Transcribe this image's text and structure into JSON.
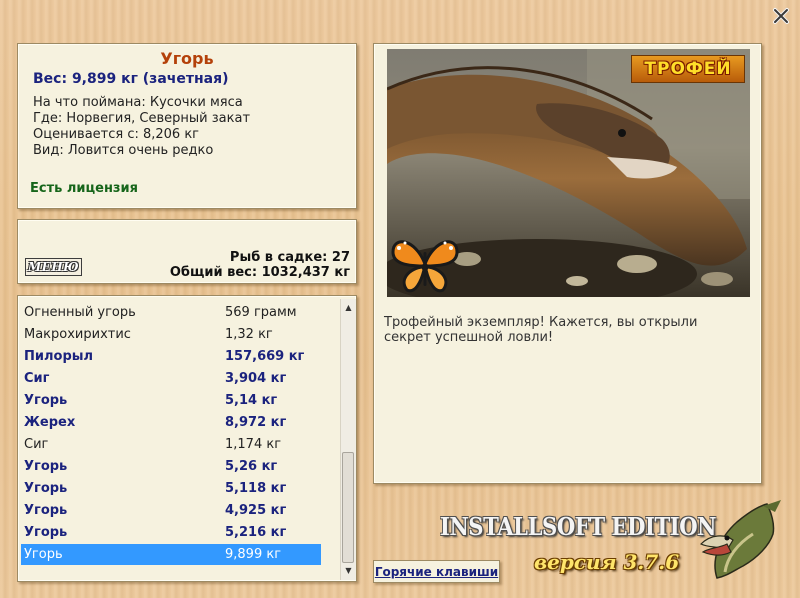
{
  "window": {
    "close_glyph": "✕"
  },
  "info": {
    "title": "Угорь",
    "weight": "Вес: 9,899 кг (зачетная)",
    "lines": [
      "На что поймана: Кусочки мяса",
      "Где: Норвегия, Северный закат",
      "Оценивается с: 8,206 кг",
      "Вид: Ловится очень редко"
    ],
    "license": "Есть лицензия"
  },
  "summary": {
    "menu_label": "МЕНЮ",
    "fish_count": "Рыб в садке: 27",
    "total_weight": "Общий вес: 1032,437 кг"
  },
  "catch_list": [
    {
      "name": "Огненный угорь",
      "weight": "569 грамм",
      "style": "normal"
    },
    {
      "name": "Макрохирихтис",
      "weight": "1,32 кг",
      "style": "normal"
    },
    {
      "name": "Пилорыл",
      "weight": "157,669 кг",
      "style": "bold"
    },
    {
      "name": "Сиг",
      "weight": "3,904 кг",
      "style": "bold"
    },
    {
      "name": "Угорь",
      "weight": "5,14 кг",
      "style": "bold"
    },
    {
      "name": "Жерех",
      "weight": "8,972 кг",
      "style": "bold"
    },
    {
      "name": "Сиг",
      "weight": "1,174 кг",
      "style": "normal"
    },
    {
      "name": "Угорь",
      "weight": "5,26 кг",
      "style": "bold"
    },
    {
      "name": "Угорь",
      "weight": "5,118 кг",
      "style": "bold"
    },
    {
      "name": "Угорь",
      "weight": "4,925 кг",
      "style": "bold"
    },
    {
      "name": "Угорь",
      "weight": "5,216 кг",
      "style": "bold"
    },
    {
      "name": "Угорь",
      "weight": "9,899 кг",
      "style": "selected"
    }
  ],
  "scrollbar": {
    "up_glyph": "▲",
    "down_glyph": "▼"
  },
  "trophy": {
    "badge": "ТРОФЕЙ",
    "description": "Трофейный экземпляр! Кажется, вы открыли секрет успешной ловли!"
  },
  "footer": {
    "hotkeys_label": "Горячие клавиши",
    "edition_title": "INSTALLSOFT EDITION",
    "version": "версия 3.7.6"
  },
  "colors": {
    "accent_title": "#b4410a",
    "accent_bold": "#1b237e",
    "license_green": "#16651a",
    "selection_blue": "#3399ff"
  }
}
